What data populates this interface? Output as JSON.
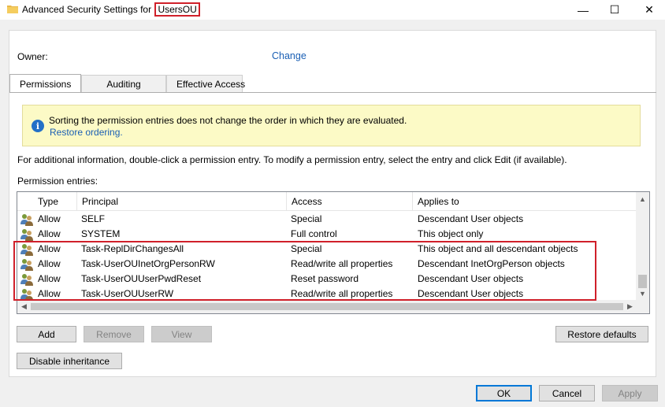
{
  "window": {
    "title_prefix": "Advanced Security Settings for",
    "title_object": "UsersOU",
    "minimize": "—",
    "maximize": "☐",
    "close": "✕"
  },
  "owner": {
    "label": "Owner:",
    "change_link": "Change"
  },
  "tabs": [
    {
      "label": "Permissions",
      "active": true
    },
    {
      "label": "Auditing",
      "active": false
    },
    {
      "label": "Effective Access",
      "active": false
    }
  ],
  "info": {
    "icon": "info-icon",
    "message": "Sorting the permission entries does not change the order in which they are evaluated.",
    "link": "Restore ordering."
  },
  "instructions": "For additional information, double-click a permission entry. To modify a permission entry, select the entry and click Edit (if available).",
  "entries_label": "Permission entries:",
  "columns": {
    "type": "Type",
    "principal": "Principal",
    "access": "Access",
    "applies_to": "Applies to"
  },
  "entries": [
    {
      "type": "Allow",
      "principal": "SELF",
      "access": "Special",
      "applies_to": "Descendant User objects"
    },
    {
      "type": "Allow",
      "principal": "SYSTEM",
      "access": "Full control",
      "applies_to": "This object only"
    },
    {
      "type": "Allow",
      "principal": "Task-ReplDirChangesAll",
      "access": "Special",
      "applies_to": "This object and all descendant objects"
    },
    {
      "type": "Allow",
      "principal": "Task-UserOUInetOrgPersonRW",
      "access": "Read/write all properties",
      "applies_to": "Descendant InetOrgPerson objects"
    },
    {
      "type": "Allow",
      "principal": "Task-UserOUUserPwdReset",
      "access": "Reset password",
      "applies_to": "Descendant User objects"
    },
    {
      "type": "Allow",
      "principal": "Task-UserOUUserRW",
      "access": "Read/write all properties",
      "applies_to": "Descendant User objects"
    }
  ],
  "buttons": {
    "add": "Add",
    "remove": "Remove",
    "view": "View",
    "restore_defaults": "Restore defaults",
    "disable_inheritance": "Disable inheritance",
    "ok": "OK",
    "cancel": "Cancel",
    "apply": "Apply"
  },
  "colors": {
    "highlight": "#d0202a",
    "link": "#1a5fb4",
    "info_bg": "#fcfac6"
  }
}
